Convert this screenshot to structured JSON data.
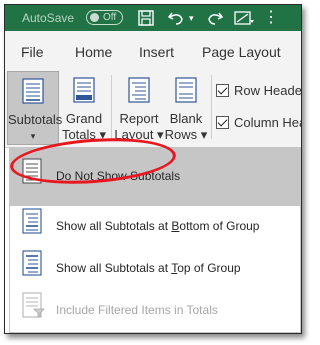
{
  "titlebar": {
    "autosave_label": "AutoSave",
    "autosave_state": "Off",
    "icons": [
      "save-icon",
      "undo-icon",
      "redo-icon",
      "customize-icon",
      "more-icon"
    ]
  },
  "menu": {
    "file": "File",
    "home": "Home",
    "insert": "Insert",
    "page_layout": "Page Layout"
  },
  "ribbon": {
    "subtotals": {
      "line1": "Subtotals",
      "arrow": "▾"
    },
    "grand_totals": {
      "line1": "Grand",
      "line2": "Totals ▾"
    },
    "report_layout": {
      "line1": "Report",
      "line2": "Layout ▾"
    },
    "blank_rows": {
      "line1": "Blank",
      "line2": "Rows ▾"
    },
    "row_headers": "Row Headers",
    "column_headers": "Column Headers"
  },
  "dropdown": {
    "items": [
      {
        "label": "Do Not Show Subtotals",
        "underline": "D",
        "rest": "o Not Show Subtotals",
        "highlighted": true
      },
      {
        "label": "Show all Subtotals at Bottom of Group",
        "pre": "Show all Subtotals at ",
        "underline": "B",
        "rest": "ottom of Group"
      },
      {
        "label": "Show all Subtotals at Top of Group",
        "pre": "Show all Subtotals at ",
        "underline": "T",
        "rest": "op of Group"
      },
      {
        "label": "Include Filtered Items in Totals",
        "disabled": true
      }
    ]
  },
  "colors": {
    "excel_green": "#217346",
    "highlight": "#c6c6c6",
    "annotation_red": "#e8161f"
  }
}
